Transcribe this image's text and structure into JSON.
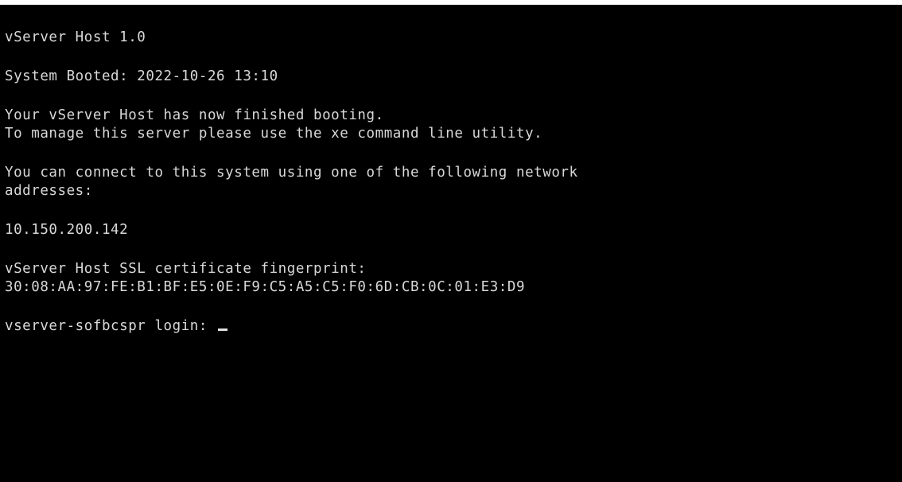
{
  "console": {
    "title": "vServer Host 1.0",
    "boot": "System Booted: 2022-10-26 13:10",
    "message_line1": "Your vServer Host has now finished booting.",
    "message_line2": "To manage this server please use the xe command line utility.",
    "connect_line1": "You can connect to this system using one of the following network",
    "connect_line2": "addresses:",
    "ip_address": "10.150.200.142",
    "ssl_label": "vServer Host SSL certificate fingerprint:",
    "ssl_fingerprint": "30:08:AA:97:FE:B1:BF:E5:0E:F9:C5:A5:C5:F0:6D:CB:0C:01:E3:D9",
    "login_prompt": "vserver-sofbcspr login: "
  },
  "colors": {
    "background": "#000000",
    "text": "#d8d8d8"
  }
}
